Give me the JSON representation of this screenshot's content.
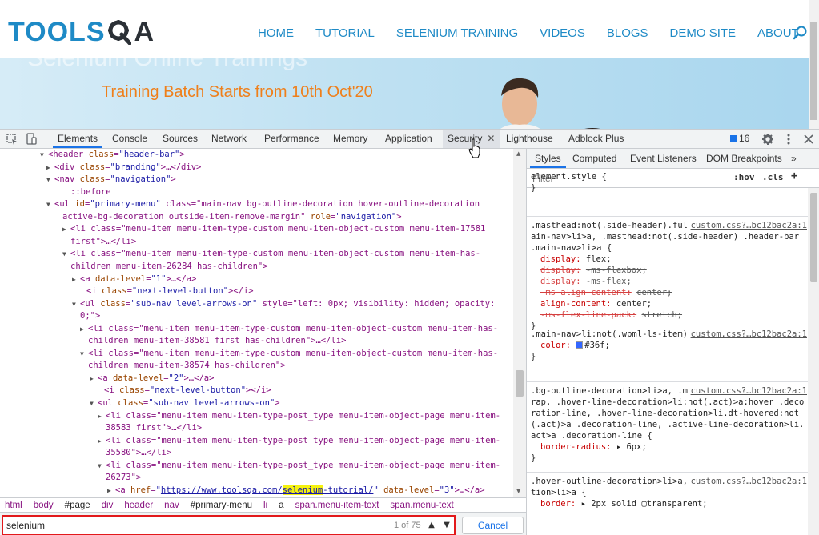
{
  "site": {
    "logo_text": "TOOLS",
    "logo_a": "A",
    "menu": [
      "HOME",
      "TUTORIAL",
      "SELENIUM TRAINING",
      "VIDEOS",
      "BLOGS",
      "DEMO SITE",
      "ABOUT"
    ],
    "banner_ghost": "Selenium Online Trainings",
    "banner_text": "Training Batch Starts from 10th Oct'20"
  },
  "devtools": {
    "tabs": [
      "Elements",
      "Console",
      "Sources",
      "Network",
      "Performance",
      "Memory",
      "Application",
      "Security",
      "Lighthouse",
      "Adblock Plus"
    ],
    "active_tab": "Elements",
    "issues_count": "16",
    "dom_lines": [
      {
        "a": "▼",
        "html": "<header class=\"header-bar\">"
      },
      {
        "a": "▶",
        "html": "<div class=\"branding\">…</div>"
      },
      {
        "a": "▼",
        "html": "<nav class=\"navigation\">"
      },
      {
        "a": "",
        "html": "::before"
      },
      {
        "a": "▼",
        "html": "<ul id=\"primary-menu\" class=\"main-nav bg-outline-decoration hover-outline-decoration"
      },
      {
        "a": "",
        "html": "active-bg-decoration outside-item-remove-margin\" role=\"navigation\">"
      },
      {
        "a": "▶",
        "html": "<li class=\"menu-item menu-item-type-custom menu-item-object-custom menu-item-17581"
      },
      {
        "a": "",
        "html": "first\">…</li>"
      },
      {
        "a": "▼",
        "html": "<li class=\"menu-item menu-item-type-custom menu-item-object-custom menu-item-has-"
      },
      {
        "a": "",
        "html": "children menu-item-26284 has-children\">"
      },
      {
        "a": "▶",
        "html": "<a data-level=\"1\">…</a>"
      },
      {
        "a": "",
        "html": "<i class=\"next-level-button\"></i>"
      },
      {
        "a": "▼",
        "html": "<ul class=\"sub-nav level-arrows-on\" style=\"left: 0px; visibility: hidden; opacity:"
      },
      {
        "a": "",
        "html": "0;\">"
      },
      {
        "a": "▶",
        "html": "<li class=\"menu-item menu-item-type-custom menu-item-object-custom menu-item-has-"
      },
      {
        "a": "",
        "html": "children menu-item-38581 first has-children\">…</li>"
      },
      {
        "a": "▼",
        "html": "<li class=\"menu-item menu-item-type-custom menu-item-object-custom menu-item-has-"
      },
      {
        "a": "",
        "html": "children menu-item-38574 has-children\">"
      },
      {
        "a": "▶",
        "html": "<a data-level=\"2\">…</a>"
      },
      {
        "a": "",
        "html": "<i class=\"next-level-button\"></i>"
      },
      {
        "a": "▼",
        "html": "<ul class=\"sub-nav level-arrows-on\">"
      },
      {
        "a": "▶",
        "html": "<li class=\"menu-item menu-item-type-post_type menu-item-object-page menu-item-"
      },
      {
        "a": "",
        "html": "38583 first\">…</li>"
      },
      {
        "a": "▶",
        "html": "<li class=\"menu-item menu-item-type-post_type menu-item-object-page menu-item-"
      },
      {
        "a": "",
        "html": "35580\">…</li>"
      },
      {
        "a": "▼",
        "html": "<li class=\"menu-item menu-item-type-post_type menu-item-object-page menu-item-"
      },
      {
        "a": "",
        "html": "26273\">"
      },
      {
        "a": "▶",
        "html": "<a href=\"https://www.toolsqa.com/selenium-tutorial/\" data-level=\"3\">…</a>"
      }
    ],
    "breadcrumbs": [
      "html",
      "body",
      "#page",
      "div",
      "header",
      "nav",
      "#primary-menu",
      "li",
      "a",
      "span.menu-item-text",
      "span.menu-text"
    ],
    "search": {
      "value": "selenium",
      "count": "1 of 75",
      "cancel_label": "Cancel"
    },
    "styles_tabs": [
      "Styles",
      "Computed",
      "Event Listeners",
      "DOM Breakpoints",
      "»"
    ],
    "filter_placeholder": "Filter",
    "hov_label": ":hov",
    "cls_label": ".cls",
    "plus_label": "+",
    "rules": [
      {
        "selector": "element.style {",
        "source": "",
        "props": [],
        "close": "}"
      },
      {
        "selector": ".masthead:not(.side-header).full-height .header-bar .main-nav>li>a, .masthead:not(.side-header) .header-bar .main-nav>li>a {",
        "source": "custom.css?…bc12bac2a:1",
        "props": [
          {
            "name": "display",
            "value": "flex;",
            "strike": false
          },
          {
            "name": "display",
            "value": "-ms-flexbox;",
            "strike": true
          },
          {
            "name": "display",
            "value": "-ms-flex;",
            "strike": true
          },
          {
            "name": "-ms-align-content",
            "value": "center;",
            "strike": true
          },
          {
            "name": "align-content",
            "value": "center;",
            "strike": false
          },
          {
            "name": "-ms-flex-line-pack",
            "value": "stretch;",
            "strike": true
          }
        ],
        "close": "}"
      },
      {
        "selector": ".main-nav>li:not(.wpml-ls-item)>a {",
        "source": "custom.css?…bc12bac2a:1",
        "props": [
          {
            "name": "color",
            "value": "#36f;",
            "strike": false,
            "swatch": "#3366ff"
          }
        ],
        "close": "}"
      },
      {
        "selector": ".bg-outline-decoration>li>a, .main-nav>li>a .animate-wrap, .hover-line-decoration>li:not(.act)>a:hover .decoration-line, .hover-line-decoration>li.dt-hovered:not(.act)>a .decoration-line, .active-line-decoration>li.act>a .decoration-line {",
        "source": "custom.css?…bc12bac2a:1",
        "props": [
          {
            "name": "border-radius",
            "value": "▸ 6px;",
            "strike": false
          }
        ],
        "close": "}"
      },
      {
        "selector": ".hover-outline-decoration>li>a, .active-outline-decoration>li>a {",
        "source": "custom.css?…bc12bac2a:1",
        "props": [
          {
            "name": "border",
            "value": "▸ 2px solid ▢transparent;",
            "strike": false
          }
        ],
        "close": ""
      }
    ]
  }
}
